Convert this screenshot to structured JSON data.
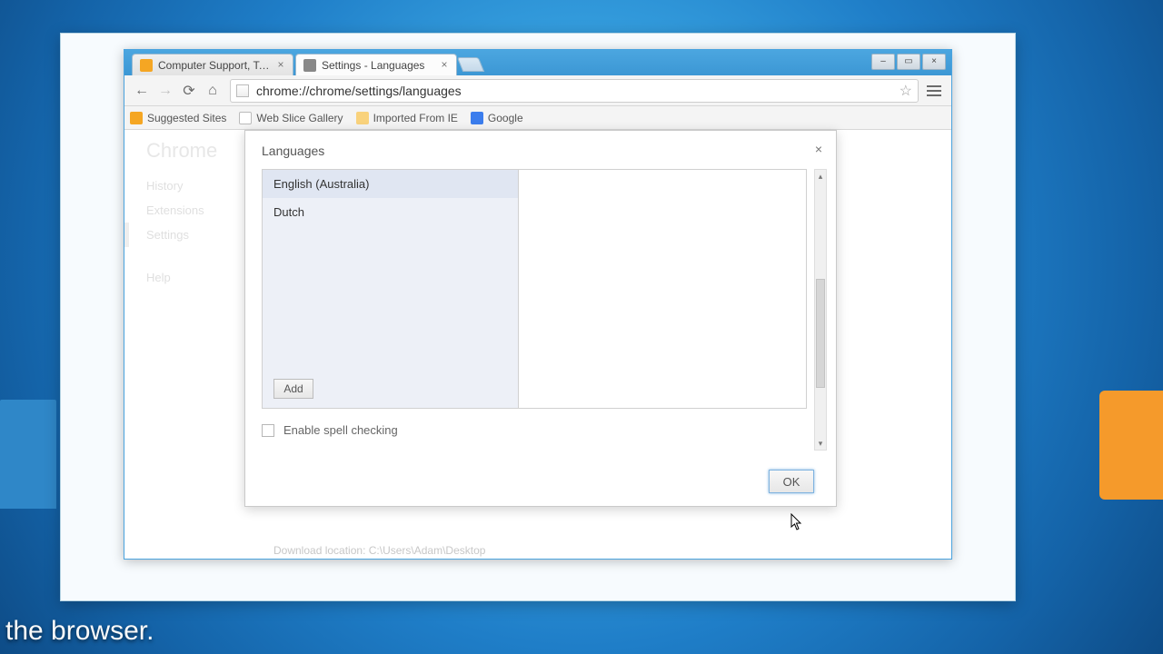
{
  "window": {
    "tabs": [
      {
        "label": "Computer Support, Tech"
      },
      {
        "label": "Settings - Languages"
      }
    ],
    "newtab_icon": "new-tab",
    "caption": {
      "min": "–",
      "max": "▭",
      "close": "×"
    }
  },
  "toolbar": {
    "back": "←",
    "forward": "→",
    "reload": "⟳",
    "home": "⌂",
    "url": "chrome://chrome/settings/languages",
    "star": "☆",
    "menu": "≡"
  },
  "bookmarks": [
    {
      "label": "Suggested Sites",
      "icon_class": "o"
    },
    {
      "label": "Web Slice Gallery",
      "icon_class": "d"
    },
    {
      "label": "Imported From IE",
      "icon_class": "f"
    },
    {
      "label": "Google",
      "icon_class": "g"
    }
  ],
  "chrome_heading": "Chrome",
  "sidenav": {
    "items": [
      "History",
      "Extensions",
      "Settings",
      "Help"
    ],
    "selected_index": 2
  },
  "dialog": {
    "title": "Languages",
    "close": "×",
    "languages": [
      "English (Australia)",
      "Dutch"
    ],
    "selected_index": 0,
    "add_label": "Add",
    "spellcheck_label": "Enable spell checking",
    "ok_label": "OK",
    "scroll_up": "▴",
    "scroll_down": "▾"
  },
  "undertext": "Download location: C:\\Users\\Adam\\Desktop",
  "subtitle": "the browser."
}
